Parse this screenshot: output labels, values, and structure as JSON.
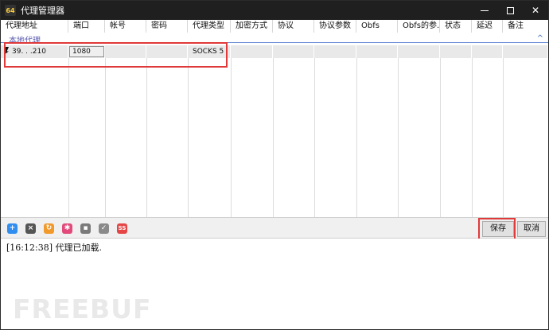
{
  "window": {
    "app_icon_text": "64",
    "title": "代理管理器",
    "minimize_icon": "minimize-icon",
    "maximize_icon": "maximize-icon",
    "close_label": "✕"
  },
  "table": {
    "columns": [
      "代理地址",
      "端口",
      "帐号",
      "密码",
      "代理类型",
      "加密方式",
      "协议",
      "协议参数",
      "Obfs",
      "Obfs的参...",
      "状态",
      "延迟",
      "备注"
    ],
    "group_label": "本地代理",
    "group_caret": "^",
    "rows": [
      {
        "address": "39.  .  .210",
        "port": "1080",
        "account": "",
        "password": "",
        "proxy_type": "SOCKS 5",
        "encryption": "",
        "protocol": "",
        "protocol_params": "",
        "obfs": "",
        "obfs_params": "",
        "status": "",
        "latency": "",
        "note": ""
      }
    ]
  },
  "toolbar": {
    "tools": [
      "add-icon",
      "delete-icon",
      "refresh-icon",
      "settings-icon",
      "shield-icon",
      "check-icon",
      "ss-icon"
    ],
    "ss_label": "SS",
    "save_label": "保存",
    "cancel_label": "取消"
  },
  "log": {
    "line": "[16:12:38]  代理已加载."
  },
  "watermark": "FREEBUF",
  "colors": {
    "titlebar": "#1f1f1f",
    "highlight_red": "#e03a3a",
    "group_blue": "#6d8ed8"
  }
}
